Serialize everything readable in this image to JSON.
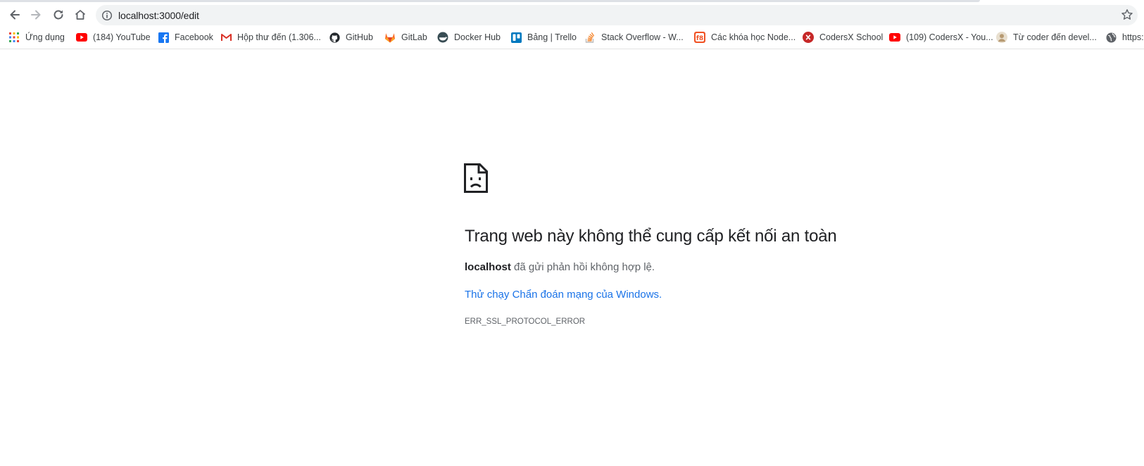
{
  "address_bar": {
    "url": "localhost:3000/edit"
  },
  "bookmarks": [
    {
      "label": "Ứng dụng",
      "icon": "apps-grid-icon"
    },
    {
      "label": "(184) YouTube",
      "icon": "youtube-icon",
      "color": "#ff0000"
    },
    {
      "label": "Facebook",
      "icon": "facebook-icon",
      "color": "#1877f2"
    },
    {
      "label": "Hộp thư đến (1.306...",
      "icon": "gmail-icon",
      "color": "#d93025"
    },
    {
      "label": "GitHub",
      "icon": "github-icon",
      "color": "#24292e"
    },
    {
      "label": "GitLab",
      "icon": "gitlab-icon",
      "color": "#fc6d26"
    },
    {
      "label": "Docker Hub",
      "icon": "docker-icon",
      "color": "#394d54"
    },
    {
      "label": "Bảng | Trello",
      "icon": "trello-icon",
      "color": "#0079bf"
    },
    {
      "label": "Stack Overflow - W...",
      "icon": "stackoverflow-icon",
      "color": "#f48024"
    },
    {
      "label": "Các khóa học Node...",
      "icon": "f8-icon",
      "color": "#f05123"
    },
    {
      "label": "CodersX School",
      "icon": "codersx-icon",
      "color": "#c62828"
    },
    {
      "label": "(109) CodersX - You...",
      "icon": "youtube-icon",
      "color": "#ff0000"
    },
    {
      "label": "Từ coder đến devel...",
      "icon": "avatar-icon"
    },
    {
      "label": "https:",
      "icon": "globe-icon",
      "color": "#5f6368"
    }
  ],
  "error": {
    "title": "Trang web này không thể cung cấp kết nối an toàn",
    "host": "localhost",
    "message": "đã gửi phản hồi không hợp lệ.",
    "link_text": "Thử chạy Chẩn đoán mạng của Windows",
    "link_suffix": ".",
    "code": "ERR_SSL_PROTOCOL_ERROR"
  }
}
